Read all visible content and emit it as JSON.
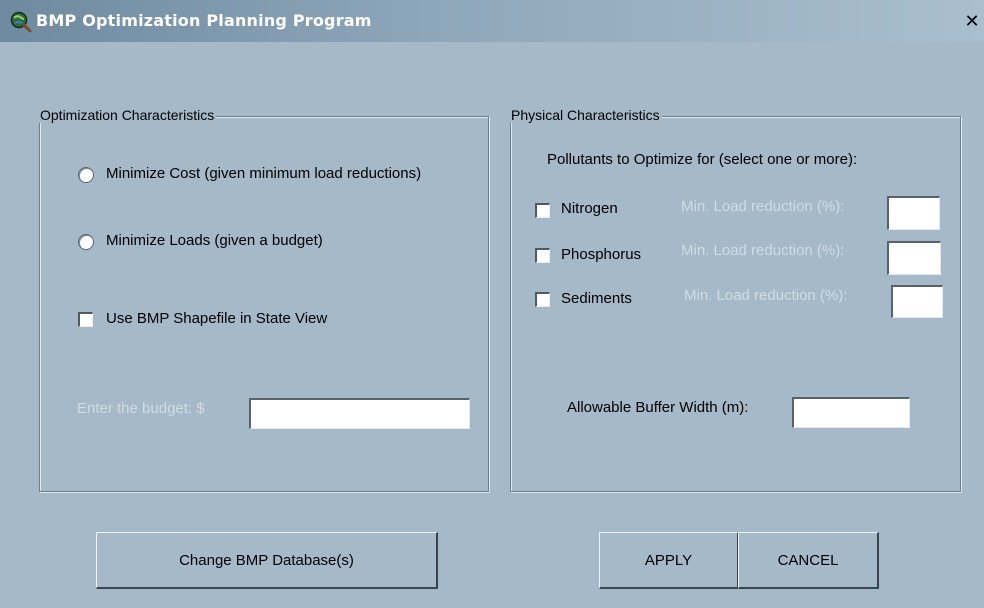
{
  "window": {
    "title": "BMP Optimization Planning Program",
    "close_glyph": "✕"
  },
  "optimization": {
    "legend": "Optimization Characteristics",
    "radio_min_cost": "Minimize Cost (given minimum load reductions)",
    "radio_min_loads": "Minimize Loads (given a budget)",
    "checkbox_shapefile": "Use BMP Shapefile in State View",
    "budget_label": "Enter the budget:  $",
    "budget_value": ""
  },
  "physical": {
    "legend": "Physical Characteristics",
    "pollutants_header": "Pollutants to Optimize for (select one or more):",
    "pollutants": [
      {
        "label": "Nitrogen",
        "min_label": "Min. Load reduction (%):",
        "value": ""
      },
      {
        "label": "Phosphorus",
        "min_label": "Min. Load reduction (%):",
        "value": ""
      },
      {
        "label": "Sediments",
        "min_label": "Min. Load reduction (%):",
        "value": ""
      }
    ],
    "buffer_label": "Allowable Buffer Width (m):",
    "buffer_value": ""
  },
  "buttons": {
    "change_db": "Change BMP Database(s)",
    "apply": "APPLY",
    "cancel": "CANCEL"
  },
  "icons": {
    "app_icon": "globe-magnifier-icon",
    "close_icon": "close-icon"
  }
}
